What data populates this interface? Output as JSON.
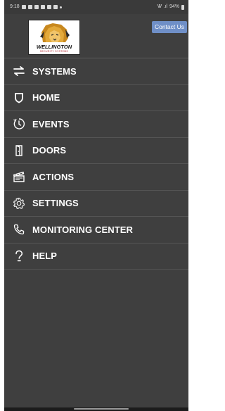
{
  "status_bar": {
    "time": "9:18",
    "battery": "94%",
    "signal_text": "Ꮤ .ıl"
  },
  "header": {
    "logo_text": "WELLINGTON",
    "logo_subtext": "SECURITY SYSTEMS",
    "contact_button": "Contact Us"
  },
  "menu": {
    "items": [
      {
        "label": "SYSTEMS",
        "icon": "swap-arrows-icon"
      },
      {
        "label": "HOME",
        "icon": "shield-icon"
      },
      {
        "label": "EVENTS",
        "icon": "history-clock-icon"
      },
      {
        "label": "DOORS",
        "icon": "door-icon"
      },
      {
        "label": "ACTIONS",
        "icon": "clapperboard-icon"
      },
      {
        "label": "SETTINGS",
        "icon": "gear-icon"
      },
      {
        "label": "MONITORING CENTER",
        "icon": "phone-icon"
      },
      {
        "label": "HELP",
        "icon": "question-icon"
      }
    ]
  },
  "colors": {
    "panel_bg": "#3f3f3f",
    "contact_button_bg": "#6f8fc7",
    "text": "#ffffff"
  }
}
